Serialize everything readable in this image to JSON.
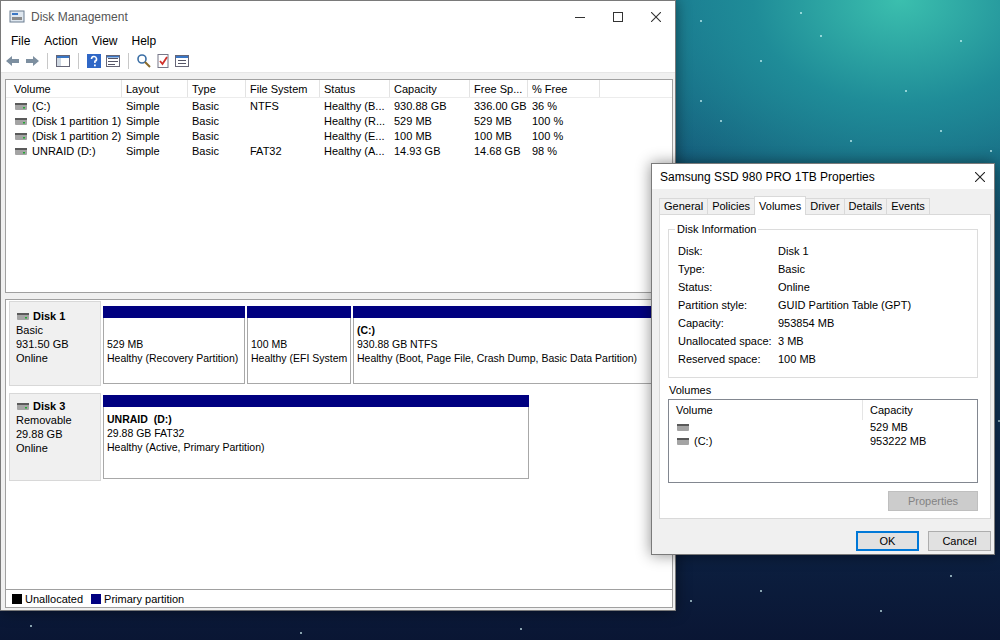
{
  "disk_management": {
    "title": "Disk Management",
    "menu": [
      "File",
      "Action",
      "View",
      "Help"
    ],
    "table": {
      "columns": [
        "Volume",
        "Layout",
        "Type",
        "File System",
        "Status",
        "Capacity",
        "Free Sp...",
        "% Free"
      ],
      "rows": [
        [
          "(C:)",
          "Simple",
          "Basic",
          "NTFS",
          "Healthy (B...",
          "930.88 GB",
          "336.00 GB",
          "36 %"
        ],
        [
          "(Disk 1 partition 1)",
          "Simple",
          "Basic",
          "",
          "Healthy (R...",
          "529 MB",
          "529 MB",
          "100 %"
        ],
        [
          "(Disk 1 partition 2)",
          "Simple",
          "Basic",
          "",
          "Healthy (E...",
          "100 MB",
          "100 MB",
          "100 %"
        ],
        [
          "UNRAID (D:)",
          "Simple",
          "Basic",
          "FAT32",
          "Healthy (A...",
          "14.93 GB",
          "14.68 GB",
          "98 %"
        ]
      ]
    },
    "disks": [
      {
        "name": "Disk 1",
        "type": "Basic",
        "size": "931.50 GB",
        "status": "Online",
        "partitions": [
          {
            "size": "529 MB",
            "status": "Healthy (Recovery Partition)"
          },
          {
            "size": "100 MB",
            "status": "Healthy (EFI System"
          },
          {
            "label": "(C:)",
            "size": "930.88 GB NTFS",
            "status": "Healthy (Boot, Page File, Crash Dump, Basic Data Partition)"
          }
        ]
      },
      {
        "name": "Disk 3",
        "type": "Removable",
        "size": "29.88 GB",
        "status": "Online",
        "partitions": [
          {
            "label": "UNRAID  (D:)",
            "size": "29.88 GB FAT32",
            "status": "Healthy (Active, Primary Partition)"
          }
        ]
      }
    ],
    "legend": [
      {
        "label": "Unallocated",
        "color": "#000000"
      },
      {
        "label": "Primary partition",
        "color": "#000080"
      }
    ]
  },
  "properties": {
    "title": "Samsung SSD 980 PRO 1TB Properties",
    "tabs": [
      {
        "label": "General",
        "selected": false
      },
      {
        "label": "Policies",
        "selected": false
      },
      {
        "label": "Volumes",
        "selected": true
      },
      {
        "label": "Driver",
        "selected": false
      },
      {
        "label": "Details",
        "selected": false
      },
      {
        "label": "Events",
        "selected": false
      }
    ],
    "group": "Disk Information",
    "fields": [
      {
        "label": "Disk:",
        "value": "Disk 1"
      },
      {
        "label": "Type:",
        "value": "Basic"
      },
      {
        "label": "Status:",
        "value": "Online"
      },
      {
        "label": "Partition style:",
        "value": "GUID Partition Table (GPT)"
      },
      {
        "label": "Capacity:",
        "value": "953854 MB"
      },
      {
        "label": "Unallocated space:",
        "value": "3 MB"
      },
      {
        "label": "Reserved space:",
        "value": "100 MB"
      }
    ],
    "volumes_label": "Volumes",
    "volumes": {
      "columns": [
        "Volume",
        "Capacity"
      ],
      "rows": [
        {
          "volume": "",
          "capacity": "529 MB"
        },
        {
          "volume": "(C:)",
          "capacity": "953222 MB"
        }
      ]
    },
    "properties_button": {
      "label": "Properties",
      "disabled": true
    },
    "buttons": [
      {
        "label": "OK",
        "default": true
      },
      {
        "label": "Cancel",
        "default": false
      }
    ]
  }
}
